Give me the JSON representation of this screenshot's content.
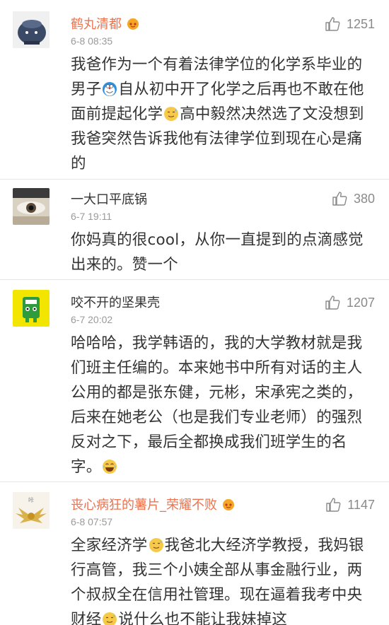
{
  "comments": [
    {
      "username": "鹤丸清都",
      "timestamp": "6-8 08:35",
      "likes": "1251",
      "text_parts": [
        "我爸作为一个有着法律学位的化学系毕业的男子",
        "自从初中开了化学之后再也不敢在他面前提起化学",
        "高中毅然决然选了文没想到我爸突然告诉我他有法律学位到现在心是痛的"
      ]
    },
    {
      "username": "一大口平底锅",
      "timestamp": "6-7 19:11",
      "likes": "380",
      "text_parts": [
        "你妈真的很cool，从你一直提到的点滴感觉出来的。赞一个"
      ]
    },
    {
      "username": "咬不开的坚果壳",
      "timestamp": "6-7 20:02",
      "likes": "1207",
      "text_parts": [
        "哈哈哈，我学韩语的，我的大学教材就是我们班主任编的。本来她书中所有对话的主人公用的都是张东健，元彬，宋承宪之类的，后来在她老公（也是我们专业老师）的强烈反对之下，最后全都换成我们班学生的名字。"
      ]
    },
    {
      "username": "丧心病狂的薯片_荣耀不败",
      "timestamp": "6-8 07:57",
      "likes": "1147",
      "text_parts": [
        "全家经济学",
        "我爸北大经济学教授，我妈银行高管，我三个小姨全部从事金融行业，两个叔叔全在信用社管理。现在逼着我考中央财经",
        "说什么也不能让我妹掉这"
      ]
    }
  ],
  "colors": {
    "username_highlight": "#eb7350",
    "text": "#333333",
    "meta": "#9a9a9a",
    "divider": "#e6e6e6"
  },
  "icons": {
    "like": "thumbs-up-icon",
    "vip": "vip-crown-badge-icon",
    "emoji_sweat": "sweat-smile-emoji-icon",
    "emoji_laugh": "laugh-tears-emoji-icon",
    "emoji_doraemon": "doraemon-emoji-icon"
  }
}
